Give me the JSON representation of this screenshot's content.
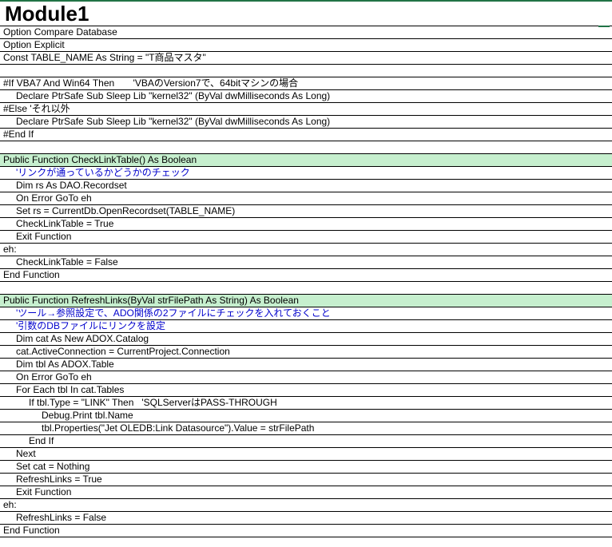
{
  "sheet": {
    "title": "Module1",
    "colors": {
      "highlight": "#c6efce",
      "comment": "#0000cc",
      "border": "#000000",
      "accent": "#217346"
    },
    "lines": [
      {
        "text": "Option Compare Database",
        "indent": 0,
        "style": "normal"
      },
      {
        "text": "Option Explicit",
        "indent": 0,
        "style": "normal"
      },
      {
        "text": "Const TABLE_NAME As String = \"T商品マスタ\"",
        "indent": 0,
        "style": "normal"
      },
      {
        "text": "",
        "indent": 0,
        "style": "normal"
      },
      {
        "text": "#If VBA7 And Win64 Then       'VBAのVersion7で、64bitマシンの場合",
        "indent": 0,
        "style": "normal"
      },
      {
        "text": "Declare PtrSafe Sub Sleep Lib \"kernel32\" (ByVal dwMilliseconds As Long)",
        "indent": 1,
        "style": "normal"
      },
      {
        "text": "#Else 'それ以外",
        "indent": 0,
        "style": "normal"
      },
      {
        "text": "Declare PtrSafe Sub Sleep Lib \"kernel32\" (ByVal dwMilliseconds As Long)",
        "indent": 1,
        "style": "normal"
      },
      {
        "text": "#End If",
        "indent": 0,
        "style": "normal"
      },
      {
        "text": "",
        "indent": 0,
        "style": "normal"
      },
      {
        "text": "Public Function CheckLinkTable() As Boolean",
        "indent": 0,
        "style": "highlight"
      },
      {
        "text": "'リンクが通っているかどうかのチェック",
        "indent": 1,
        "style": "comment"
      },
      {
        "text": "Dim rs As DAO.Recordset",
        "indent": 1,
        "style": "normal"
      },
      {
        "text": "On Error GoTo eh",
        "indent": 1,
        "style": "normal"
      },
      {
        "text": "Set rs = CurrentDb.OpenRecordset(TABLE_NAME)",
        "indent": 1,
        "style": "normal"
      },
      {
        "text": "CheckLinkTable = True",
        "indent": 1,
        "style": "normal"
      },
      {
        "text": "Exit Function",
        "indent": 1,
        "style": "normal"
      },
      {
        "text": "eh:",
        "indent": 0,
        "style": "normal"
      },
      {
        "text": "CheckLinkTable = False",
        "indent": 1,
        "style": "normal"
      },
      {
        "text": "End Function",
        "indent": 0,
        "style": "normal"
      },
      {
        "text": "",
        "indent": 0,
        "style": "normal"
      },
      {
        "text": "Public Function RefreshLinks(ByVal strFilePath As String) As Boolean",
        "indent": 0,
        "style": "highlight"
      },
      {
        "text": "'ツール→参照設定で、ADO関係の2ファイルにチェックを入れておくこと",
        "indent": 1,
        "style": "comment"
      },
      {
        "text": "'引数のDBファイルにリンクを設定",
        "indent": 1,
        "style": "comment"
      },
      {
        "text": "Dim cat As New ADOX.Catalog",
        "indent": 1,
        "style": "normal"
      },
      {
        "text": "cat.ActiveConnection = CurrentProject.Connection",
        "indent": 1,
        "style": "normal"
      },
      {
        "text": "Dim tbl As ADOX.Table",
        "indent": 1,
        "style": "normal"
      },
      {
        "text": "On Error GoTo eh",
        "indent": 1,
        "style": "normal"
      },
      {
        "text": "For Each tbl In cat.Tables",
        "indent": 1,
        "style": "normal"
      },
      {
        "text": "If tbl.Type = \"LINK\" Then   'SQLServerはPASS-THROUGH",
        "indent": 2,
        "style": "normal"
      },
      {
        "text": "Debug.Print tbl.Name",
        "indent": 3,
        "style": "normal"
      },
      {
        "text": "tbl.Properties(\"Jet OLEDB:Link Datasource\").Value = strFilePath",
        "indent": 3,
        "style": "normal"
      },
      {
        "text": "End If",
        "indent": 2,
        "style": "normal"
      },
      {
        "text": "Next",
        "indent": 1,
        "style": "normal"
      },
      {
        "text": "Set cat = Nothing",
        "indent": 1,
        "style": "normal"
      },
      {
        "text": "RefreshLinks = True",
        "indent": 1,
        "style": "normal"
      },
      {
        "text": "Exit Function",
        "indent": 1,
        "style": "normal"
      },
      {
        "text": "eh:",
        "indent": 0,
        "style": "normal"
      },
      {
        "text": "RefreshLinks = False",
        "indent": 1,
        "style": "normal"
      },
      {
        "text": "End Function",
        "indent": 0,
        "style": "normal"
      }
    ]
  }
}
